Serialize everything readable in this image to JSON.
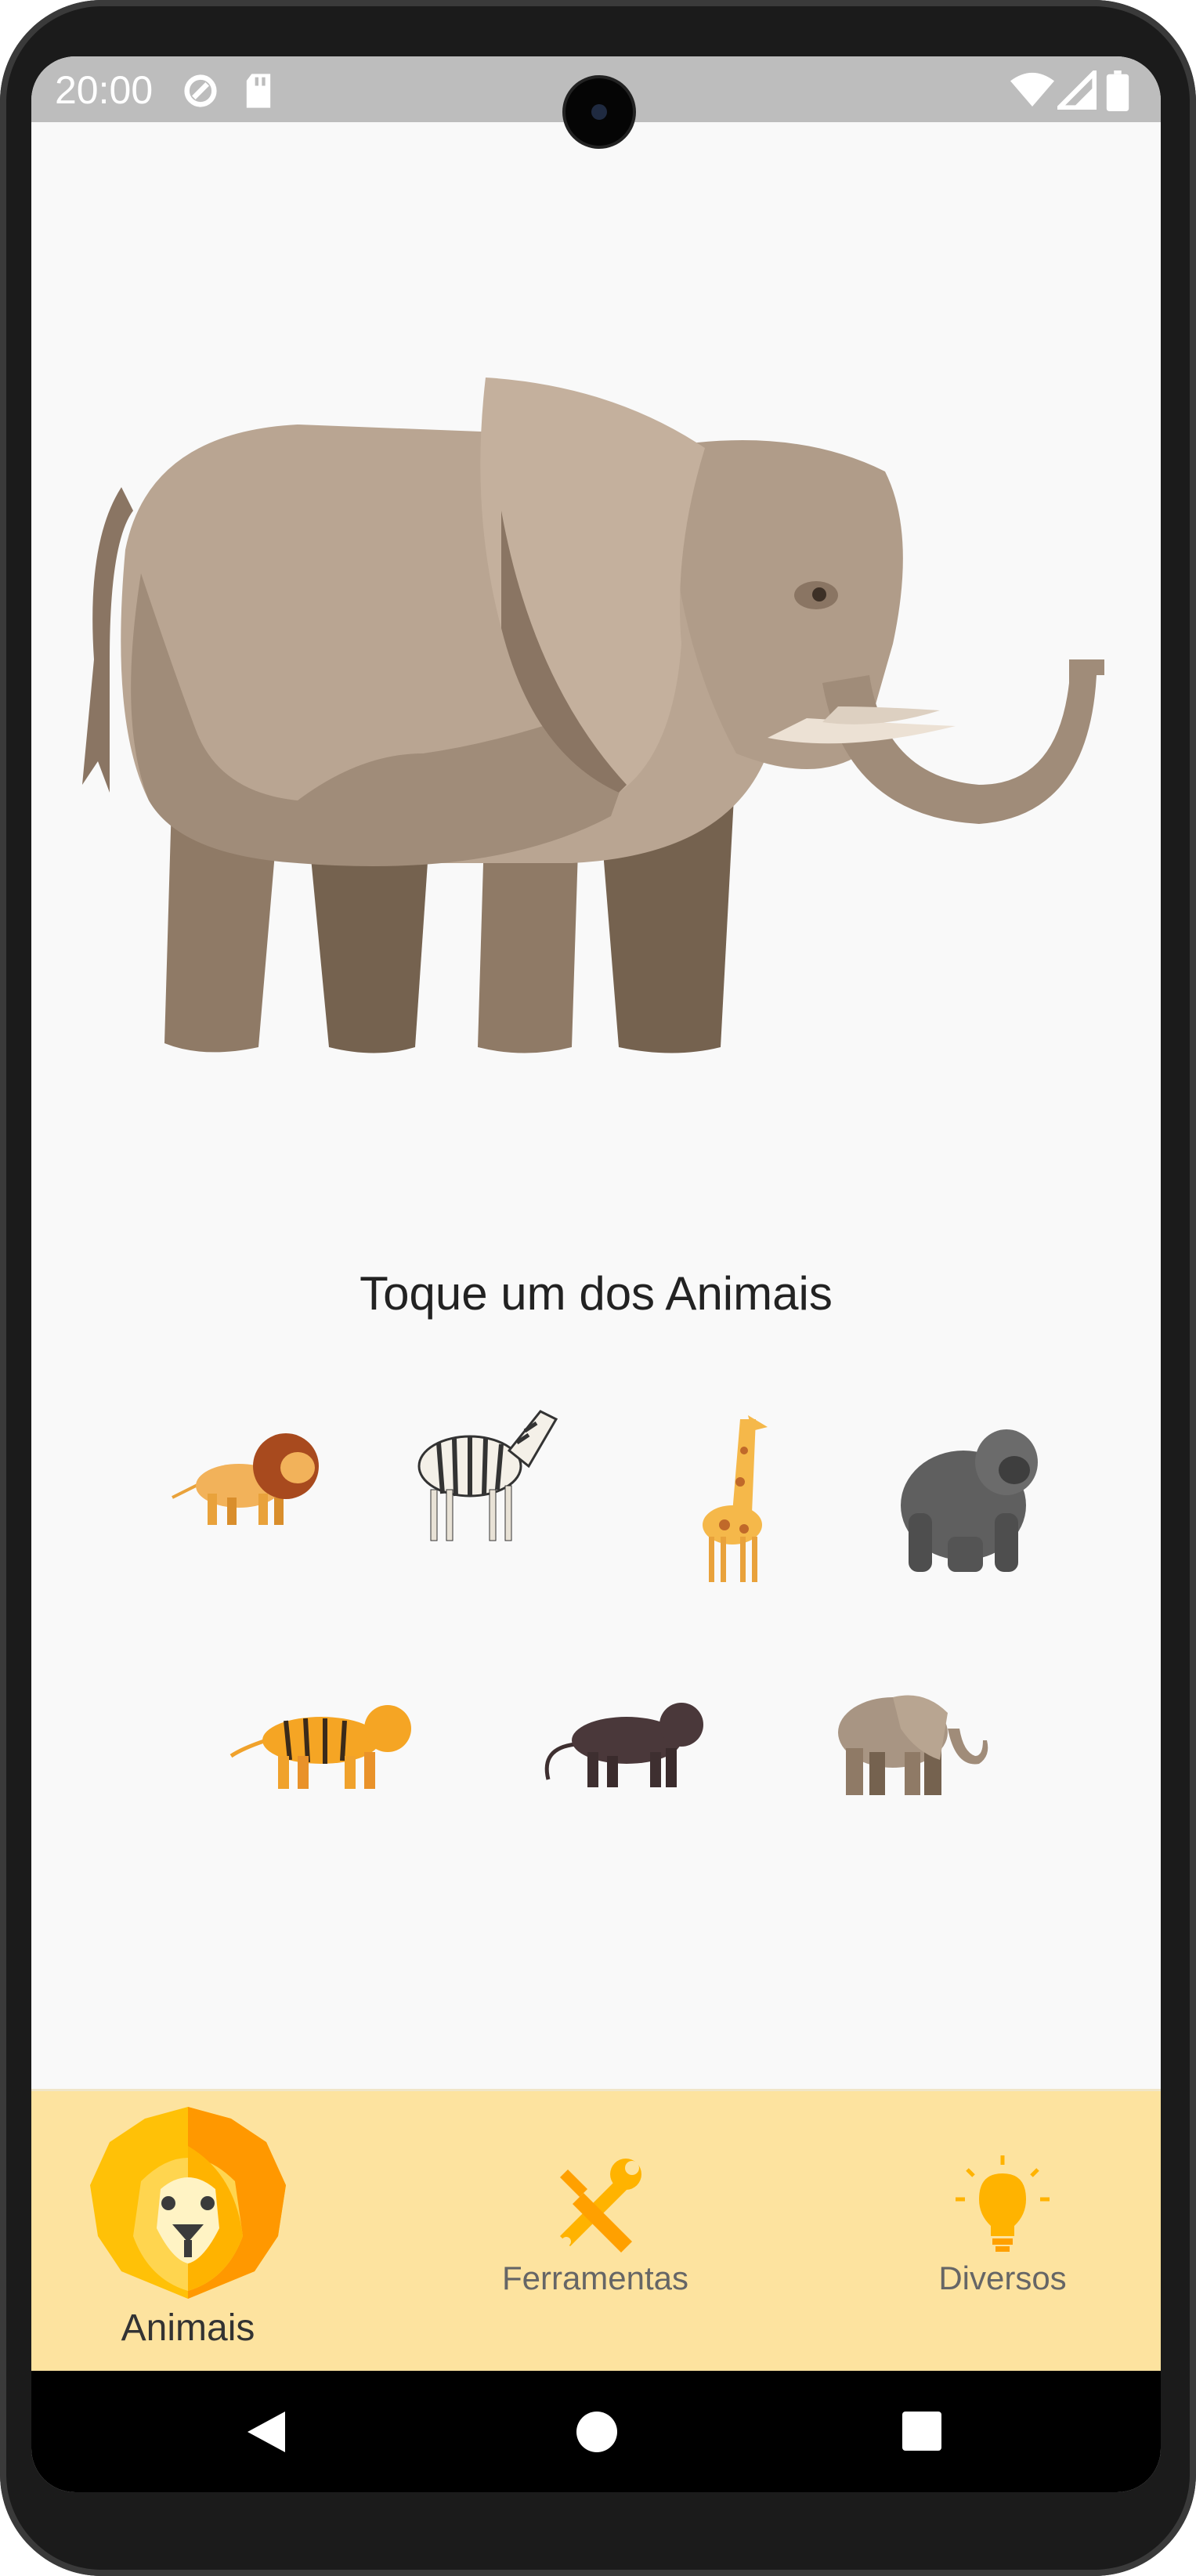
{
  "status_bar": {
    "time": "20:00"
  },
  "main": {
    "prompt": "Toque um dos Animais"
  },
  "animals": [
    {
      "name": "lion"
    },
    {
      "name": "zebra"
    },
    {
      "name": "giraffe"
    },
    {
      "name": "gorilla"
    },
    {
      "name": "tiger"
    },
    {
      "name": "panther"
    },
    {
      "name": "elephant"
    }
  ],
  "bottom_nav": {
    "items": [
      {
        "label": "Animais",
        "active": true
      },
      {
        "label": "Ferramentas",
        "active": false
      },
      {
        "label": "Diversos",
        "active": false
      }
    ]
  },
  "colors": {
    "nav_background": "#fde39f",
    "accent": "#ffb300",
    "status_bar": "#bdbdbd"
  }
}
